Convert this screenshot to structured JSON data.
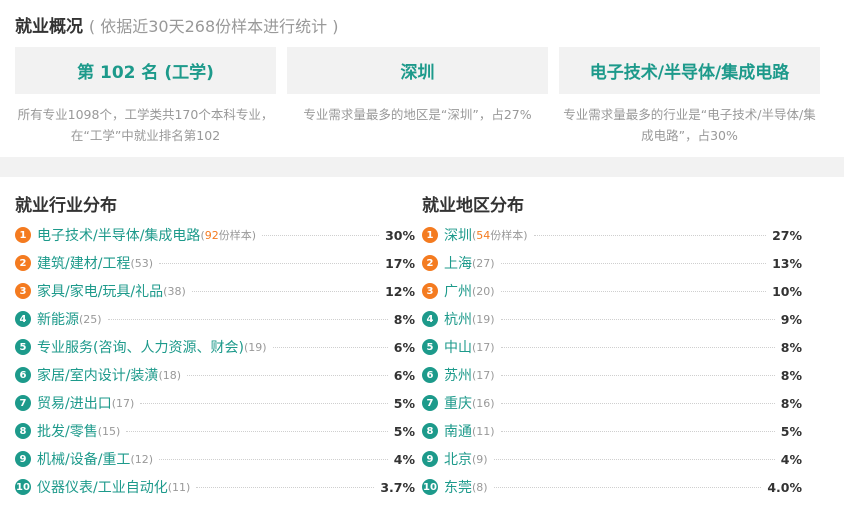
{
  "overview": {
    "title": "就业概况",
    "subtitle": "( 依据近30天268份样本进行统计 )",
    "cards": [
      {
        "value": "第 102 名 (工学)",
        "desc": "所有专业1098个，工学类共170个本科专业，在“工学”中就业排名第102"
      },
      {
        "value": "深圳",
        "desc": "专业需求量最多的地区是“深圳”，占27%"
      },
      {
        "value": "电子技术/半导体/集成电路",
        "desc": "专业需求量最多的行业是“电子技术/半导体/集成电路”，占30%"
      }
    ]
  },
  "industry": {
    "title": "就业行业分布",
    "items": [
      {
        "rank": "1",
        "name": "电子技术/半导体/集成电路",
        "count": "(92份样本)",
        "count_num": "92",
        "count_suffix": "份样本)",
        "pct": "30%"
      },
      {
        "rank": "2",
        "name": "建筑/建材/工程",
        "count": "(53)",
        "pct": "17%"
      },
      {
        "rank": "3",
        "name": "家具/家电/玩具/礼品",
        "count": "(38)",
        "pct": "12%"
      },
      {
        "rank": "4",
        "name": "新能源",
        "count": "(25)",
        "pct": "8%"
      },
      {
        "rank": "5",
        "name": "专业服务(咨询、人力资源、财会)",
        "count": "(19)",
        "pct": "6%"
      },
      {
        "rank": "6",
        "name": "家居/室内设计/装潢",
        "count": "(18)",
        "pct": "6%"
      },
      {
        "rank": "7",
        "name": "贸易/进出口",
        "count": "(17)",
        "pct": "5%"
      },
      {
        "rank": "8",
        "name": "批发/零售",
        "count": "(15)",
        "pct": "5%"
      },
      {
        "rank": "9",
        "name": "机械/设备/重工",
        "count": "(12)",
        "pct": "4%"
      },
      {
        "rank": "10",
        "name": "仪器仪表/工业自动化",
        "count": "(11)",
        "pct": "3.7%"
      }
    ]
  },
  "region": {
    "title": "就业地区分布",
    "items": [
      {
        "rank": "1",
        "name": "深圳",
        "count": "(54份样本)",
        "count_num": "54",
        "count_suffix": "份样本)",
        "pct": "27%"
      },
      {
        "rank": "2",
        "name": "上海",
        "count": "(27)",
        "pct": "13%"
      },
      {
        "rank": "3",
        "name": "广州",
        "count": "(20)",
        "pct": "10%"
      },
      {
        "rank": "4",
        "name": "杭州",
        "count": "(19)",
        "pct": "9%"
      },
      {
        "rank": "5",
        "name": "中山",
        "count": "(17)",
        "pct": "8%"
      },
      {
        "rank": "6",
        "name": "苏州",
        "count": "(17)",
        "pct": "8%"
      },
      {
        "rank": "7",
        "name": "重庆",
        "count": "(16)",
        "pct": "8%"
      },
      {
        "rank": "8",
        "name": "南通",
        "count": "(11)",
        "pct": "5%"
      },
      {
        "rank": "9",
        "name": "北京",
        "count": "(9)",
        "pct": "4%"
      },
      {
        "rank": "10",
        "name": "东莞",
        "count": "(8)",
        "pct": "4.0%"
      }
    ]
  },
  "colors": {
    "accent": "#1d9a8b",
    "highlight": "#f47b20",
    "muted": "#999999",
    "card_bg": "#f2f2f2"
  }
}
